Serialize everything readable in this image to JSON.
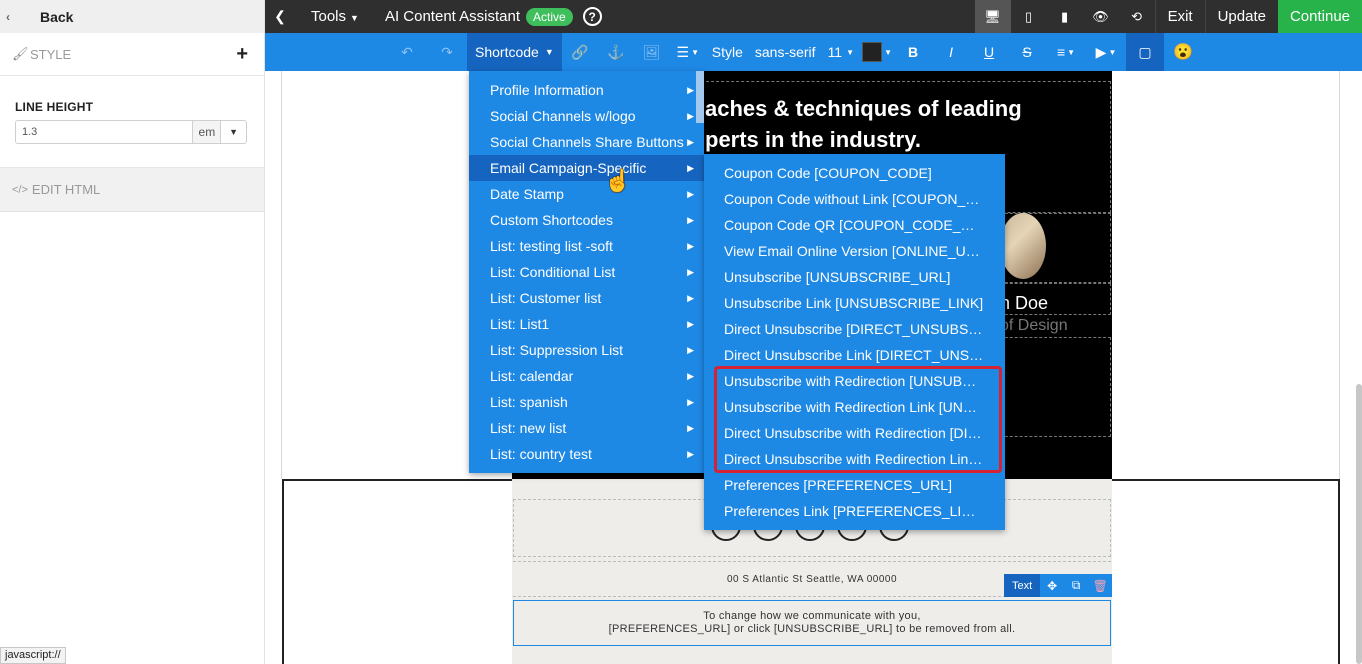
{
  "left_panel": {
    "back_label": "Back",
    "style_label": "STYLE",
    "add_label": "+",
    "line_height_label": "LINE HEIGHT",
    "line_height_value": "1.3",
    "line_height_unit": "em",
    "edit_html_label": "EDIT HTML",
    "status_tip": "javascript://"
  },
  "topbar": {
    "tools_label": "Tools",
    "ai_label": "AI Content Assistant",
    "ai_status": "Active",
    "help_label": "?",
    "exit_label": "Exit",
    "update_label": "Update",
    "continue_label": "Continue"
  },
  "toolbar": {
    "shortcode_label": "Shortcode",
    "style_label": "Style",
    "font_family": "sans-serif",
    "font_size": "11",
    "bold": "B",
    "italic": "I",
    "underline": "U",
    "strike": "S",
    "emoji": "😮"
  },
  "canvas": {
    "heading_line1": "aches & techniques of leading",
    "heading_line2": "perts in the industry.",
    "name": "n Doe",
    "role": "of Design",
    "address": "00 S Atlantic St Seattle, WA 00000",
    "pref_line1": "To change how we communicate with you,",
    "pref_line2": "[PREFERENCES_URL] or click [UNSUBSCRIBE_URL] to be removed from all.",
    "chip_label": "Text"
  },
  "shortcode_menu": [
    "Profile Information",
    "Social Channels w/logo",
    "Social Channels Share Buttons",
    "Email Campaign-Specific",
    "Date Stamp",
    "Custom Shortcodes",
    "List: testing list -soft",
    "List: Conditional List",
    "List: Customer list",
    "List: List1",
    "List: Suppression List",
    "List: calendar",
    "List: spanish",
    "List: new list",
    "List: country test"
  ],
  "sub_menu": [
    "Coupon Code [COUPON_CODE]",
    "Coupon Code without Link [COUPON_…",
    "Coupon Code QR [COUPON_CODE_…",
    "View Email Online Version [ONLINE_U…",
    "Unsubscribe [UNSUBSCRIBE_URL]",
    "Unsubscribe Link [UNSUBSCRIBE_LINK]",
    "Direct Unsubscribe [DIRECT_UNSUBS…",
    "Direct Unsubscribe Link [DIRECT_UNS…",
    "Unsubscribe with Redirection [UNSUB…",
    "Unsubscribe with Redirection Link [UN…",
    "Direct Unsubscribe with Redirection [DI…",
    "Direct Unsubscribe with Redirection Lin…",
    "Preferences [PREFERENCES_URL]",
    "Preferences Link [PREFERENCES_LI…"
  ],
  "colors": {
    "accent": "#1e88e5",
    "accent_dark": "#1565c0",
    "topbar": "#2f2f2f",
    "continue": "#27b24a",
    "highlight": "#d62233"
  }
}
